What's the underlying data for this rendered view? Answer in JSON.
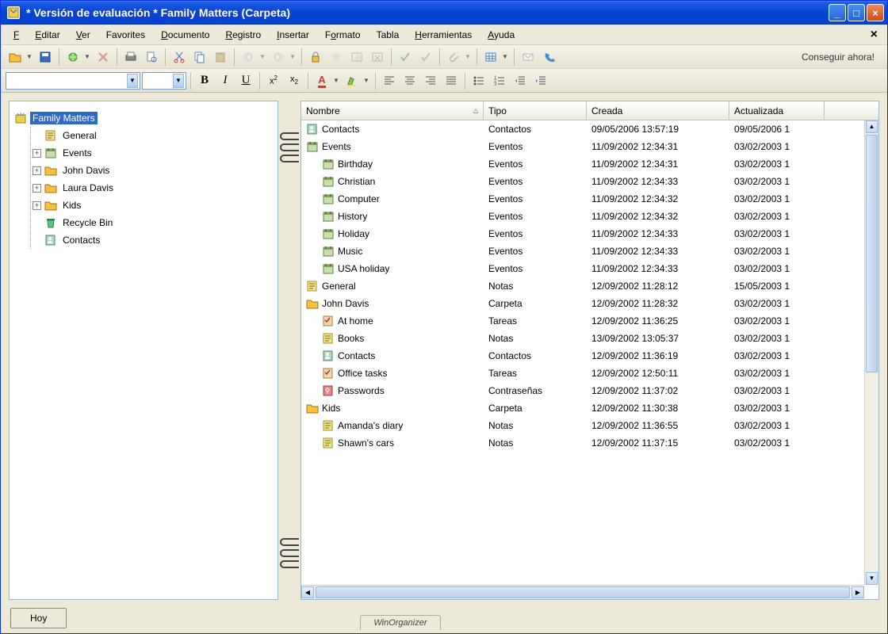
{
  "title": "* Versión de evaluación * Family Matters (Carpeta)",
  "menu": [
    "Fichero",
    "Editar",
    "Ver",
    "Favorites",
    "Documento",
    "Registro",
    "Insertar",
    "Formato",
    "Tabla",
    "Herramientas",
    "Ayuda"
  ],
  "toolbar_right": "Conseguir ahora!",
  "footer_button": "Hoy",
  "footer_tab": "WinOrganizer",
  "tree": {
    "root": "Family Matters",
    "items": [
      {
        "label": "General",
        "exp": "",
        "icon": "note"
      },
      {
        "label": "Events",
        "exp": "+",
        "icon": "event"
      },
      {
        "label": "John Davis",
        "exp": "+",
        "icon": "folder"
      },
      {
        "label": "Laura Davis",
        "exp": "+",
        "icon": "folder"
      },
      {
        "label": "Kids",
        "exp": "+",
        "icon": "folder"
      },
      {
        "label": "Recycle Bin",
        "exp": "",
        "icon": "bin"
      },
      {
        "label": "Contacts",
        "exp": "",
        "icon": "contacts"
      }
    ]
  },
  "columns": {
    "nombre": "Nombre",
    "tipo": "Tipo",
    "creada": "Creada",
    "actualizada": "Actualizada"
  },
  "rows": [
    {
      "indent": 0,
      "icon": "contacts",
      "nombre": "Contacts",
      "tipo": "Contactos",
      "creada": "09/05/2006 13:57:19",
      "actual": "09/05/2006 1"
    },
    {
      "indent": 0,
      "icon": "event",
      "nombre": "Events",
      "tipo": "Eventos",
      "creada": "11/09/2002 12:34:31",
      "actual": "03/02/2003 1"
    },
    {
      "indent": 1,
      "icon": "event",
      "nombre": "Birthday",
      "tipo": "Eventos",
      "creada": "11/09/2002 12:34:31",
      "actual": "03/02/2003 1"
    },
    {
      "indent": 1,
      "icon": "event",
      "nombre": "Christian",
      "tipo": "Eventos",
      "creada": "11/09/2002 12:34:33",
      "actual": "03/02/2003 1"
    },
    {
      "indent": 1,
      "icon": "event",
      "nombre": "Computer",
      "tipo": "Eventos",
      "creada": "11/09/2002 12:34:32",
      "actual": "03/02/2003 1"
    },
    {
      "indent": 1,
      "icon": "event",
      "nombre": "History",
      "tipo": "Eventos",
      "creada": "11/09/2002 12:34:32",
      "actual": "03/02/2003 1"
    },
    {
      "indent": 1,
      "icon": "event",
      "nombre": "Holiday",
      "tipo": "Eventos",
      "creada": "11/09/2002 12:34:33",
      "actual": "03/02/2003 1"
    },
    {
      "indent": 1,
      "icon": "event",
      "nombre": "Music",
      "tipo": "Eventos",
      "creada": "11/09/2002 12:34:33",
      "actual": "03/02/2003 1"
    },
    {
      "indent": 1,
      "icon": "event",
      "nombre": "USA holiday",
      "tipo": "Eventos",
      "creada": "11/09/2002 12:34:33",
      "actual": "03/02/2003 1"
    },
    {
      "indent": 0,
      "icon": "note",
      "nombre": "General",
      "tipo": "Notas",
      "creada": "12/09/2002 11:28:12",
      "actual": "15/05/2003 1"
    },
    {
      "indent": 0,
      "icon": "folder",
      "nombre": "John Davis",
      "tipo": "Carpeta",
      "creada": "12/09/2002 11:28:32",
      "actual": "03/02/2003 1"
    },
    {
      "indent": 1,
      "icon": "task",
      "nombre": "At home",
      "tipo": "Tareas",
      "creada": "12/09/2002 11:36:25",
      "actual": "03/02/2003 1"
    },
    {
      "indent": 1,
      "icon": "note",
      "nombre": "Books",
      "tipo": "Notas",
      "creada": "13/09/2002 13:05:37",
      "actual": "03/02/2003 1"
    },
    {
      "indent": 1,
      "icon": "contacts",
      "nombre": "Contacts",
      "tipo": "Contactos",
      "creada": "12/09/2002 11:36:19",
      "actual": "03/02/2003 1"
    },
    {
      "indent": 1,
      "icon": "task",
      "nombre": "Office tasks",
      "tipo": "Tareas",
      "creada": "12/09/2002 12:50:11",
      "actual": "03/02/2003 1"
    },
    {
      "indent": 1,
      "icon": "password",
      "nombre": "Passwords",
      "tipo": "Contraseñas",
      "creada": "12/09/2002 11:37:02",
      "actual": "03/02/2003 1"
    },
    {
      "indent": 0,
      "icon": "folder",
      "nombre": "Kids",
      "tipo": "Carpeta",
      "creada": "12/09/2002 11:30:38",
      "actual": "03/02/2003 1"
    },
    {
      "indent": 1,
      "icon": "note",
      "nombre": "Amanda's diary",
      "tipo": "Notas",
      "creada": "12/09/2002 11:36:55",
      "actual": "03/02/2003 1"
    },
    {
      "indent": 1,
      "icon": "note",
      "nombre": "Shawn's cars",
      "tipo": "Notas",
      "creada": "12/09/2002 11:37:15",
      "actual": "03/02/2003 1"
    }
  ],
  "icons": {
    "folder": "#f5c23e",
    "note": "#f0e890",
    "event": "#c8e0b0",
    "contacts": "#b0d8c0",
    "task": "#f0d8b0",
    "password": "#e08888",
    "bin": "#60c080",
    "root": "#e8d050"
  }
}
